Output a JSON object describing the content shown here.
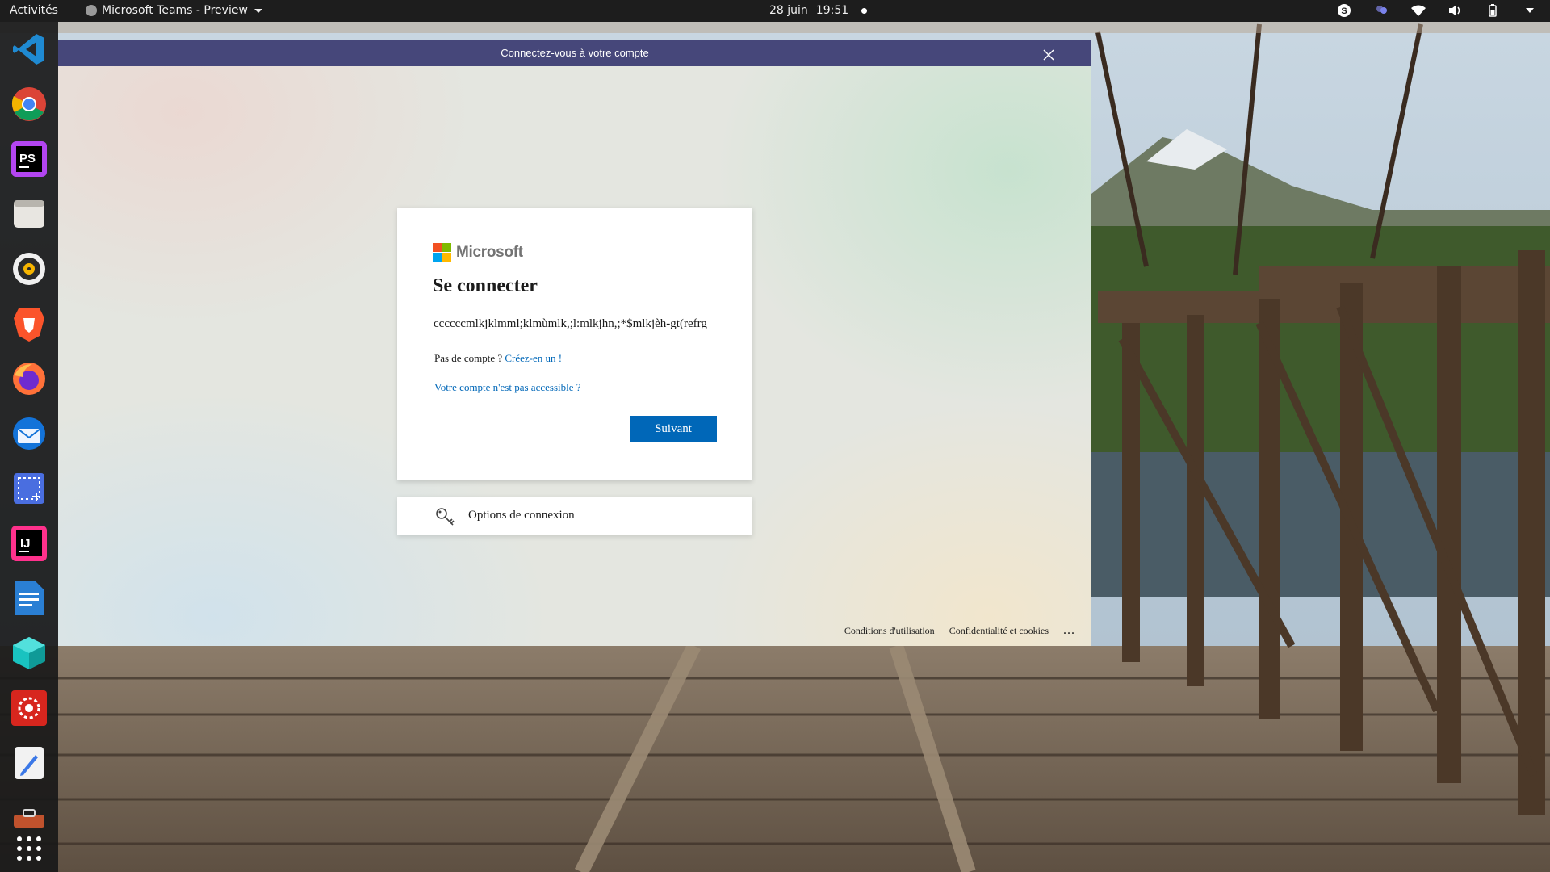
{
  "topbar": {
    "activities": "Activités",
    "app_name": "Microsoft Teams - Preview",
    "date": "28 juin",
    "time": "19:51"
  },
  "dock": {
    "items": [
      "vscode",
      "chrome",
      "phpstorm",
      "files",
      "rhythmbox",
      "brave",
      "firefox",
      "thunderbird",
      "screenshot",
      "intellij",
      "libreoffice-writer",
      "cube-app",
      "settings-app",
      "text-editor",
      "archive"
    ]
  },
  "window": {
    "title": "Connectez-vous à votre compte"
  },
  "signin": {
    "brand": "Microsoft",
    "heading": "Se connecter",
    "email_value": "ccccccmlkjklmml;klmùmlk,;l:mlkjhn,;*$mlkjèh-gt(refrg",
    "no_account_text": "Pas de compte ?",
    "create_link": "Créez-en un !",
    "inaccessible_link": "Votre compte n'est pas accessible ?",
    "next_button": "Suivant"
  },
  "options": {
    "label": "Options de connexion"
  },
  "footer": {
    "terms": "Conditions d'utilisation",
    "privacy": "Confidentialité et cookies",
    "more": "..."
  },
  "colors": {
    "accent": "#0067b8",
    "titlebar": "#46477a",
    "ms_red": "#f25022",
    "ms_green": "#7fba00",
    "ms_blue": "#00a4ef",
    "ms_yellow": "#ffb900"
  }
}
